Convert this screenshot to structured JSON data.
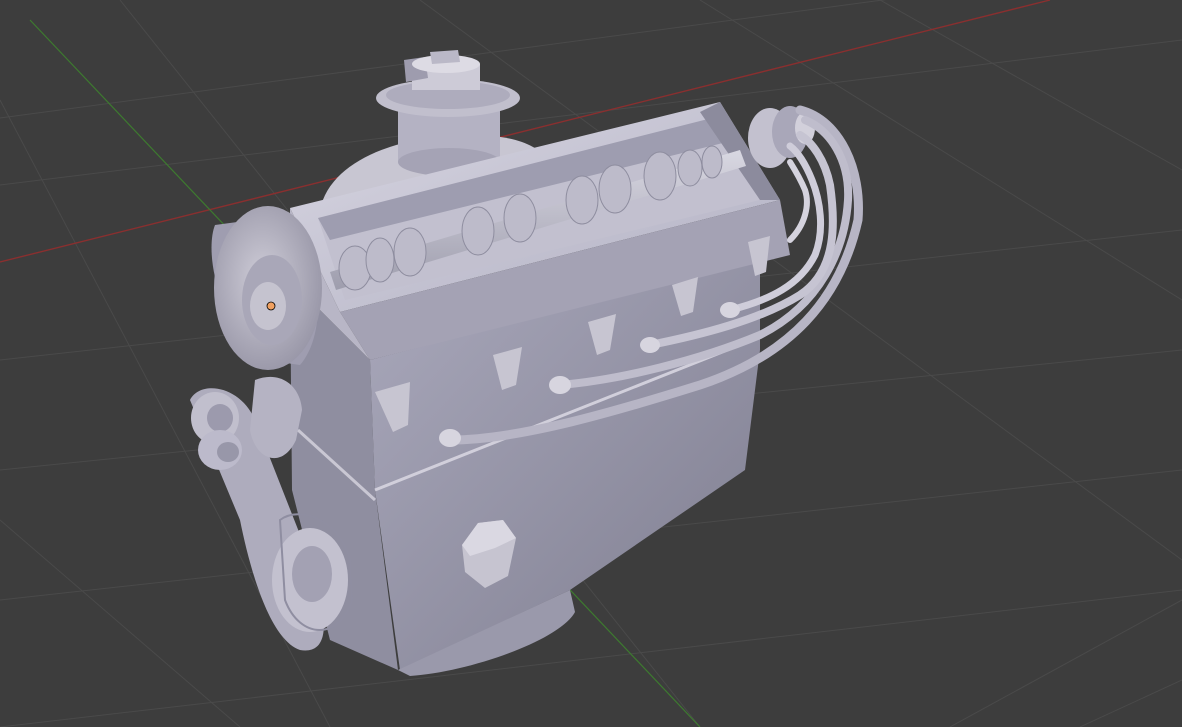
{
  "viewport": {
    "editor": "3D Viewport",
    "background_color": "#3d3d3d",
    "grid_color": "#4a4a4a",
    "x_axis_color": "#8a2f2f",
    "y_axis_color": "#3d7a2f",
    "object_origin_color": "#f0a060"
  },
  "model": {
    "object": "engine",
    "material_color": "#b9b7c8",
    "parts": [
      "engine-block",
      "cylinder-head",
      "camshaft",
      "distributor",
      "pulley",
      "belt",
      "spark-plug-wires",
      "oil-plug"
    ]
  }
}
